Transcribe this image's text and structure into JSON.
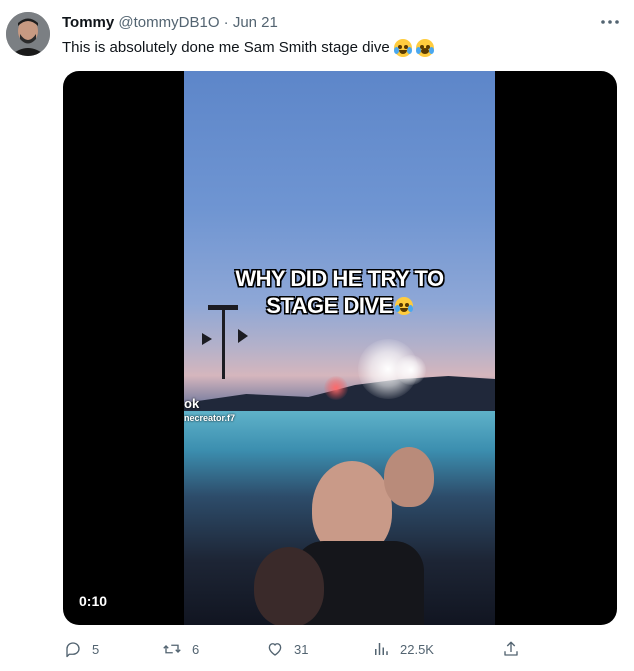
{
  "tweet": {
    "author_name": "Tommy",
    "author_handle": "@tommyDB1O",
    "separator": "·",
    "date": "Jun 21",
    "text": "This is absolutely done me Sam Smith stage dive",
    "emojis": [
      "face-with-tears-of-joy-icon",
      "loudly-crying-face-icon"
    ]
  },
  "media": {
    "caption_line1": "WHY DID HE TRY TO",
    "caption_line2": "STAGE DIVE",
    "watermark_line1": "ok",
    "watermark_line2": "necreator.f7",
    "duration": "0:10"
  },
  "actions": {
    "reply_count": "5",
    "repost_count": "6",
    "like_count": "31",
    "views_count": "22.5K"
  },
  "colors": {
    "text_primary": "#0f1419",
    "text_secondary": "#536471",
    "media_background": "#000000"
  }
}
